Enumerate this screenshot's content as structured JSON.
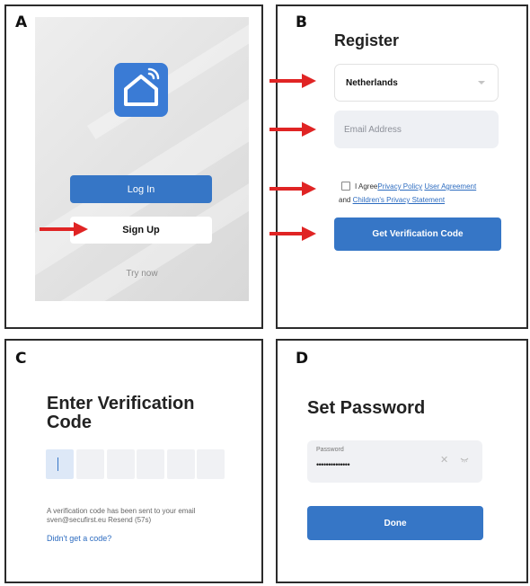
{
  "panel_a": {
    "letter": "A",
    "login_label": "Log In",
    "signup_label": "Sign Up",
    "try_now": "Try now",
    "icon": "smart-home-icon"
  },
  "panel_b": {
    "letter": "B",
    "title": "Register",
    "country": "Netherlands",
    "email_placeholder": "Email Address",
    "agree_prefix": "I Agree",
    "privacy_policy": "Privacy Policy",
    "user_agreement": "User Agreement",
    "and": "and",
    "childrens_privacy": "Children's Privacy Statement",
    "verify_label": "Get Verification Code"
  },
  "panel_c": {
    "letter": "C",
    "title": "Enter Verification Code",
    "sent_line1": "A verification code has been sent to your email",
    "sent_line2": "sven@secufirst.eu Resend (57s)",
    "no_code_link": "Didn't get a code?"
  },
  "panel_d": {
    "letter": "D",
    "title": "Set Password",
    "password_label": "Password",
    "password_value": "••••••••••••••",
    "done_label": "Done"
  },
  "colors": {
    "primary": "#3676c6",
    "arrow": "#e02424",
    "link": "#2d6cc0"
  }
}
